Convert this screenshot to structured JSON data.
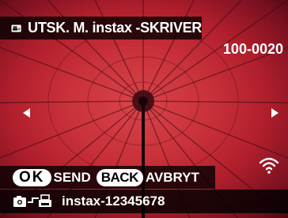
{
  "header": {
    "title": "UTSK. M. instax -SKRIVER",
    "icon": "printer-wifi-icon"
  },
  "image": {
    "file_number": "100-0020"
  },
  "actions": {
    "ok_key": "OK",
    "ok_label": "SEND",
    "back_key": "BACK",
    "back_label": "AVBRYT"
  },
  "status": {
    "printer_name": "instax-12345678",
    "connection_icon": "camera-to-printer-icon",
    "wifi_icon": "wifi-icon"
  }
}
